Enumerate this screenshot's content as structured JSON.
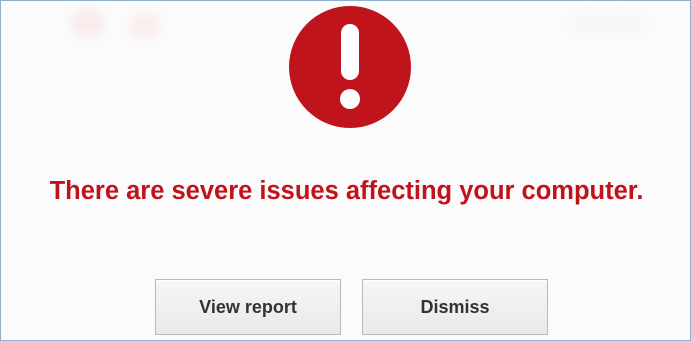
{
  "dialog": {
    "icon": "exclamation-alert-icon",
    "accent_color": "#c0141c",
    "message": "There are severe issues affecting your computer.",
    "buttons": {
      "view_report": "View report",
      "dismiss": "Dismiss"
    }
  }
}
